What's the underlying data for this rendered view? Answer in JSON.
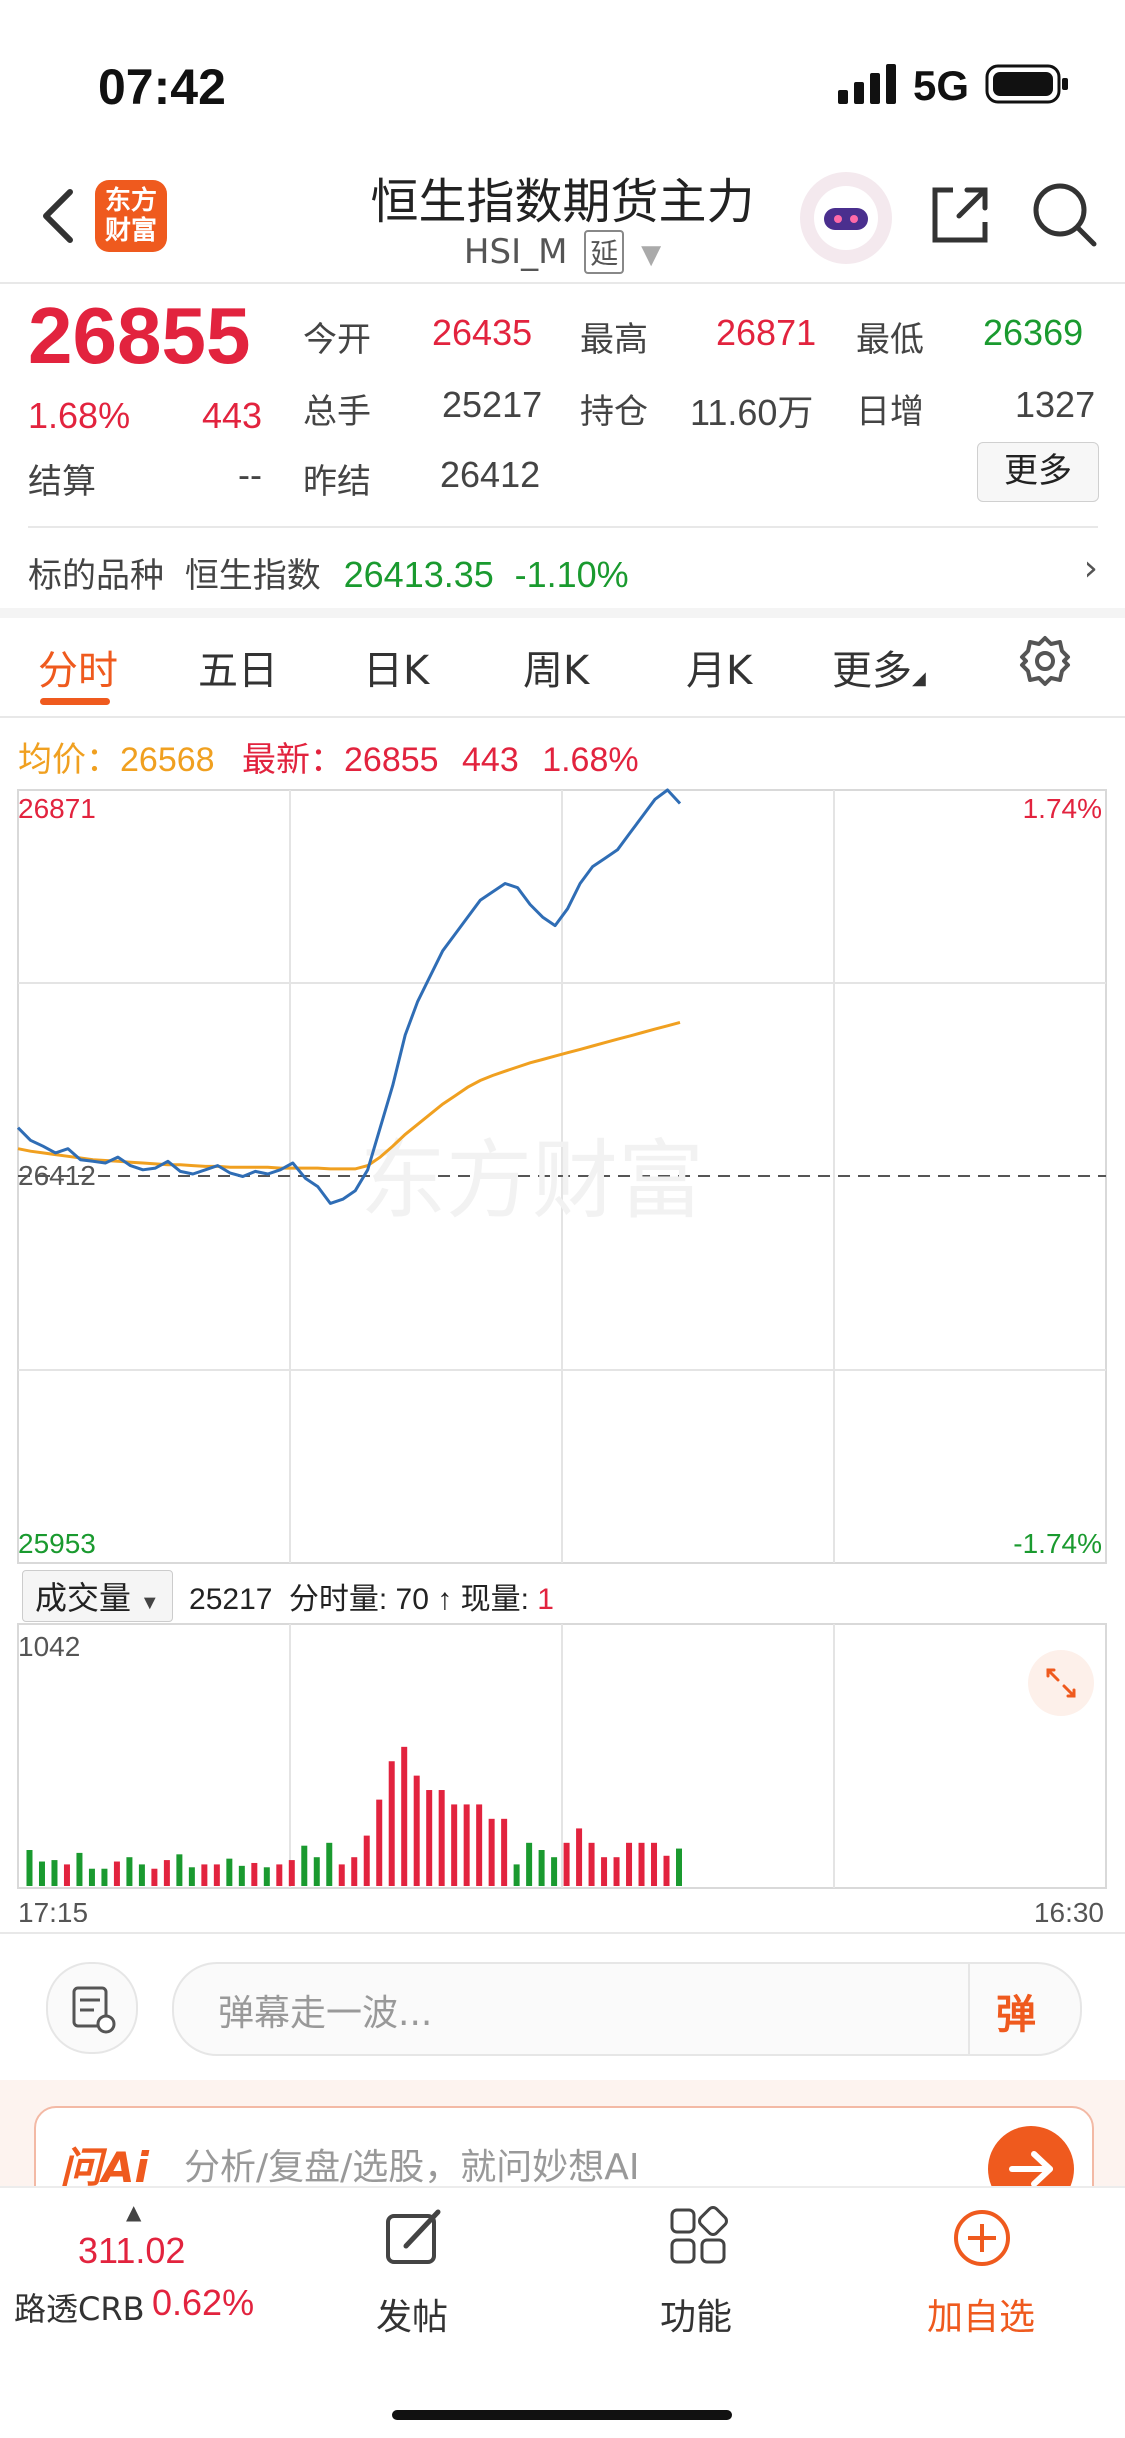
{
  "status_bar": {
    "time": "07:42",
    "network": "5G"
  },
  "header": {
    "logo_text": "东方财富",
    "title": "恒生指数期货主力",
    "code": "HSI_M",
    "delay_badge": "延"
  },
  "quote": {
    "price": "26855",
    "change_pct": "1.68%",
    "change": "443",
    "open_label": "今开",
    "open": "26435",
    "high_label": "最高",
    "high": "26871",
    "low_label": "最低",
    "low": "26369",
    "volume_label": "总手",
    "volume": "25217",
    "oi_label": "持仓",
    "oi": "11.60万",
    "daily_inc_label": "日增",
    "daily_inc": "1327",
    "settle_label": "结算",
    "settle": "--",
    "prev_settle_label": "昨结",
    "prev_settle": "26412",
    "more_label": "更多"
  },
  "underlying": {
    "label": "标的品种",
    "name": "恒生指数",
    "value": "26413.35",
    "change": "-1.10%"
  },
  "tabs": [
    "分时",
    "五日",
    "日K",
    "周K",
    "月K",
    "更多"
  ],
  "chart_header": {
    "avg_label": "均价：",
    "avg": "26568",
    "latest_label": "最新：",
    "latest": "26855",
    "latest_change": "443",
    "latest_pct": "1.68%"
  },
  "chart_data": {
    "type": "line",
    "y_max": "26871",
    "y_mid": "26412",
    "y_min": "25953",
    "pct_max": "1.74%",
    "pct_min": "-1.74%",
    "x_start": "17:15",
    "x_end": "16:30",
    "watermark": "东方财富",
    "series": [
      {
        "values": [
          26470,
          26455,
          26448,
          26440,
          26445,
          26432,
          26430,
          26428,
          26435,
          26425,
          26420,
          26422,
          26430,
          26418,
          26415,
          26420,
          26425,
          26416,
          26412,
          26418,
          26415,
          26420,
          26428,
          26410,
          26400,
          26380,
          26385,
          26395,
          26420,
          26470,
          26520,
          26580,
          26620,
          26650,
          26680,
          26700,
          26720,
          26740,
          26750,
          26760,
          26755,
          26735,
          26720,
          26710,
          26730,
          26760,
          26780,
          26790,
          26800,
          26820,
          26840,
          26860,
          26871,
          26855
        ]
      },
      {
        "values": [
          26445,
          26442,
          26440,
          26438,
          26436,
          26434,
          26432,
          26431,
          26430,
          26429,
          26428,
          26427,
          26426,
          26426,
          26425,
          26424,
          26424,
          26423,
          26423,
          26423,
          26423,
          26422,
          26422,
          26422,
          26422,
          26421,
          26421,
          26421,
          26425,
          26435,
          26448,
          26462,
          26474,
          26486,
          26498,
          26508,
          26518,
          26526,
          26532,
          26537,
          26542,
          26547,
          26551,
          26555,
          26559,
          26563,
          26567,
          26571,
          26575,
          26579,
          26583,
          26587,
          26591,
          26595
        ]
      }
    ]
  },
  "volume_panel": {
    "selector": "成交量",
    "total": "25217",
    "minute_label": "分时量:",
    "minute_vol": "70",
    "now_label": "现量:",
    "now_vol": "1",
    "max": "1042"
  },
  "comment": {
    "placeholder": "弹幕走一波...",
    "danmu": "弹"
  },
  "ai": {
    "brand": "问Ai",
    "placeholder": "分析/复盘/选股，就问妙想AI"
  },
  "bottom": {
    "crb_value": "311.02",
    "crb_label": "路透CRB",
    "crb_pct": "0.62%",
    "post": "发帖",
    "func": "功能",
    "add": "加自选"
  },
  "colors": {
    "up": "#e2233e",
    "down": "#1a9a2f",
    "accent": "#ef5a1e",
    "line": "#2f6db5",
    "avg": "#f0a020"
  }
}
